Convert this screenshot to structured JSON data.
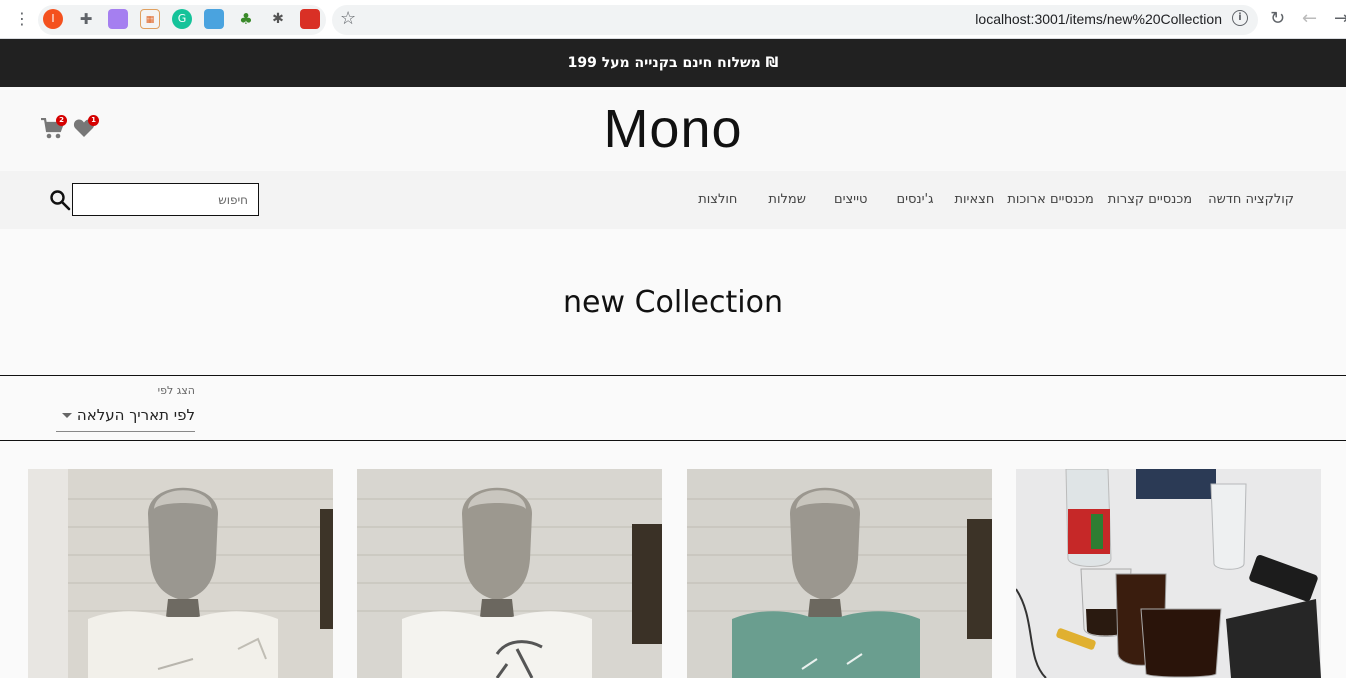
{
  "browser": {
    "url": "localhost:3001/items/new%20Collection",
    "profile_initial": "I"
  },
  "promo": {
    "text": "משלוח חינם בקנייה מעל 199 ₪"
  },
  "header": {
    "logo": "Mono",
    "cart_count": "2",
    "wishlist_count": "1"
  },
  "nav": {
    "items": [
      "קולקציה חדשה",
      "מכנסיים קצרות",
      "מכנסיים ארוכות",
      "חצאיות",
      "ג'ינסים",
      "טייצים",
      "שמלות",
      "חולצות"
    ]
  },
  "search": {
    "placeholder": "חיפוש"
  },
  "page": {
    "title": "new Collection"
  },
  "sort": {
    "label": "הצג לפי",
    "value": "לפי תאריך העלאה"
  },
  "products": [
    {
      "shirt_color": "#f2f0ea",
      "bg": "#d9d6cf"
    },
    {
      "shirt_color": "#f4f3ef",
      "bg": "#d8d6d0"
    },
    {
      "shirt_color": "#6a9e8f",
      "bg": "#d5d3cd"
    },
    {
      "shirt_color": "",
      "bg": "#e9e9ea"
    }
  ],
  "colors": {
    "promo_bg": "#212121",
    "badge": "#d50000",
    "icon": "#777777"
  }
}
